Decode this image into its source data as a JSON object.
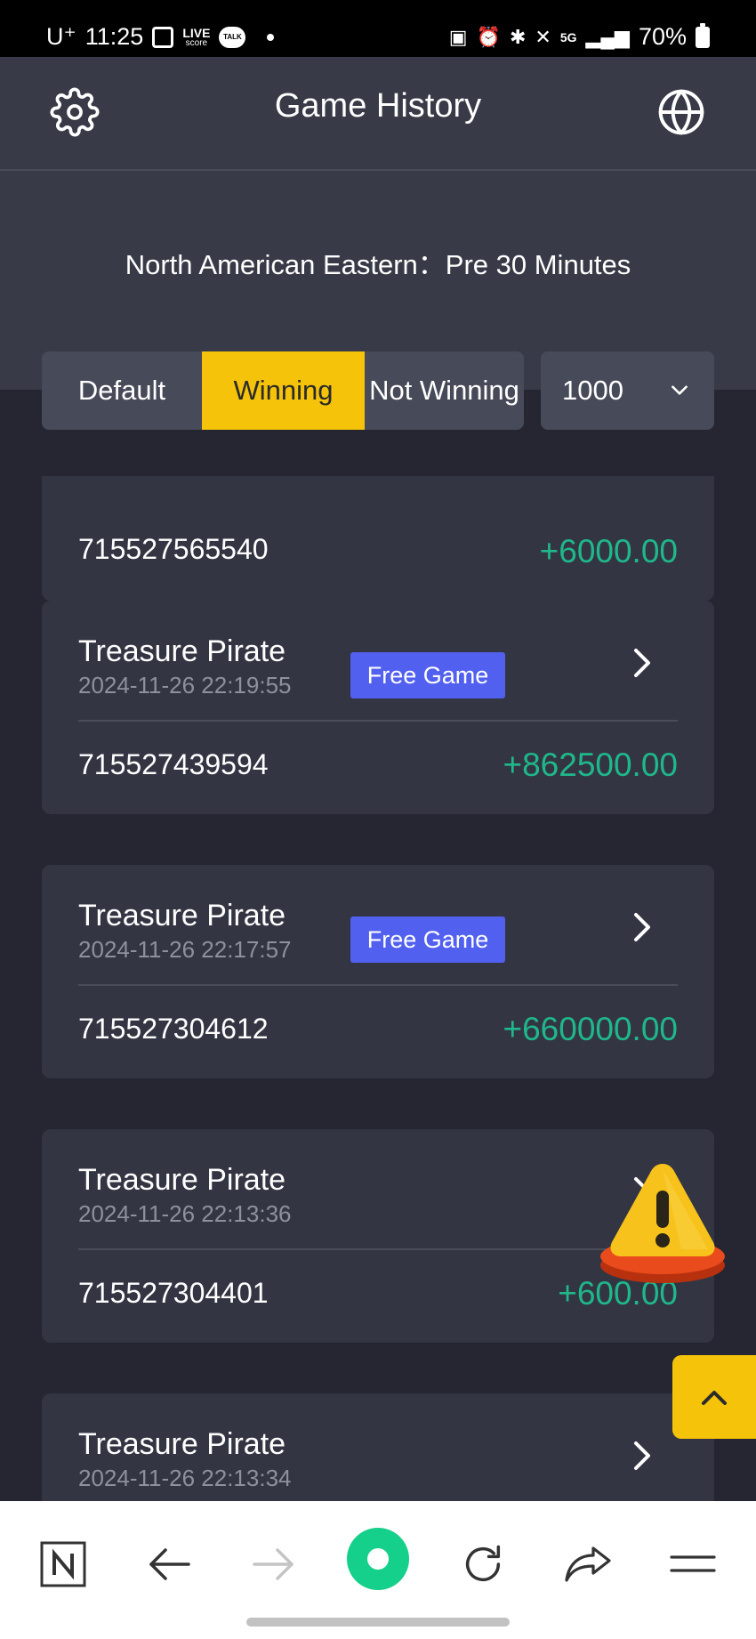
{
  "status_bar": {
    "time": "11:25",
    "carrier": "U⁺",
    "live_label": "LIVE",
    "live_sub": "score",
    "talk_label": "TALK",
    "network": "5G",
    "battery": "70%"
  },
  "header": {
    "title": "Game History",
    "settings_icon": "gear-icon",
    "language_icon": "globe-icon"
  },
  "timezone": "North American Eastern：Pre 30 Minutes",
  "filters": {
    "tabs": [
      {
        "label": "Default",
        "active": false
      },
      {
        "label": "Winning",
        "active": true
      },
      {
        "label": "Not Winning",
        "active": false
      }
    ],
    "count_value": "1000"
  },
  "records": [
    {
      "order_id": "715527565540",
      "amount": "+6000.00"
    },
    {
      "game": "Treasure Pirate",
      "datetime": "2024-11-26 22:19:55",
      "badge": "Free Game",
      "order_id": "715527439594",
      "amount": "+862500.00"
    },
    {
      "game": "Treasure Pirate",
      "datetime": "2024-11-26 22:17:57",
      "badge": "Free Game",
      "order_id": "715527304612",
      "amount": "+660000.00"
    },
    {
      "game": "Treasure Pirate",
      "datetime": "2024-11-26 22:13:36",
      "order_id": "715527304401",
      "amount": "+600.00"
    },
    {
      "game": "Treasure Pirate",
      "datetime": "2024-11-26 22:13:34"
    }
  ],
  "colors": {
    "accent": "#f4c30a",
    "win": "#1fb88a",
    "badge": "#5260f0",
    "background": "#252632",
    "card": "#333543"
  },
  "browser_bar": {
    "icons": [
      "naver-n-icon",
      "back-arrow-icon",
      "forward-arrow-icon",
      "home-circle-icon",
      "reload-icon",
      "share-icon",
      "menu-icon"
    ]
  }
}
